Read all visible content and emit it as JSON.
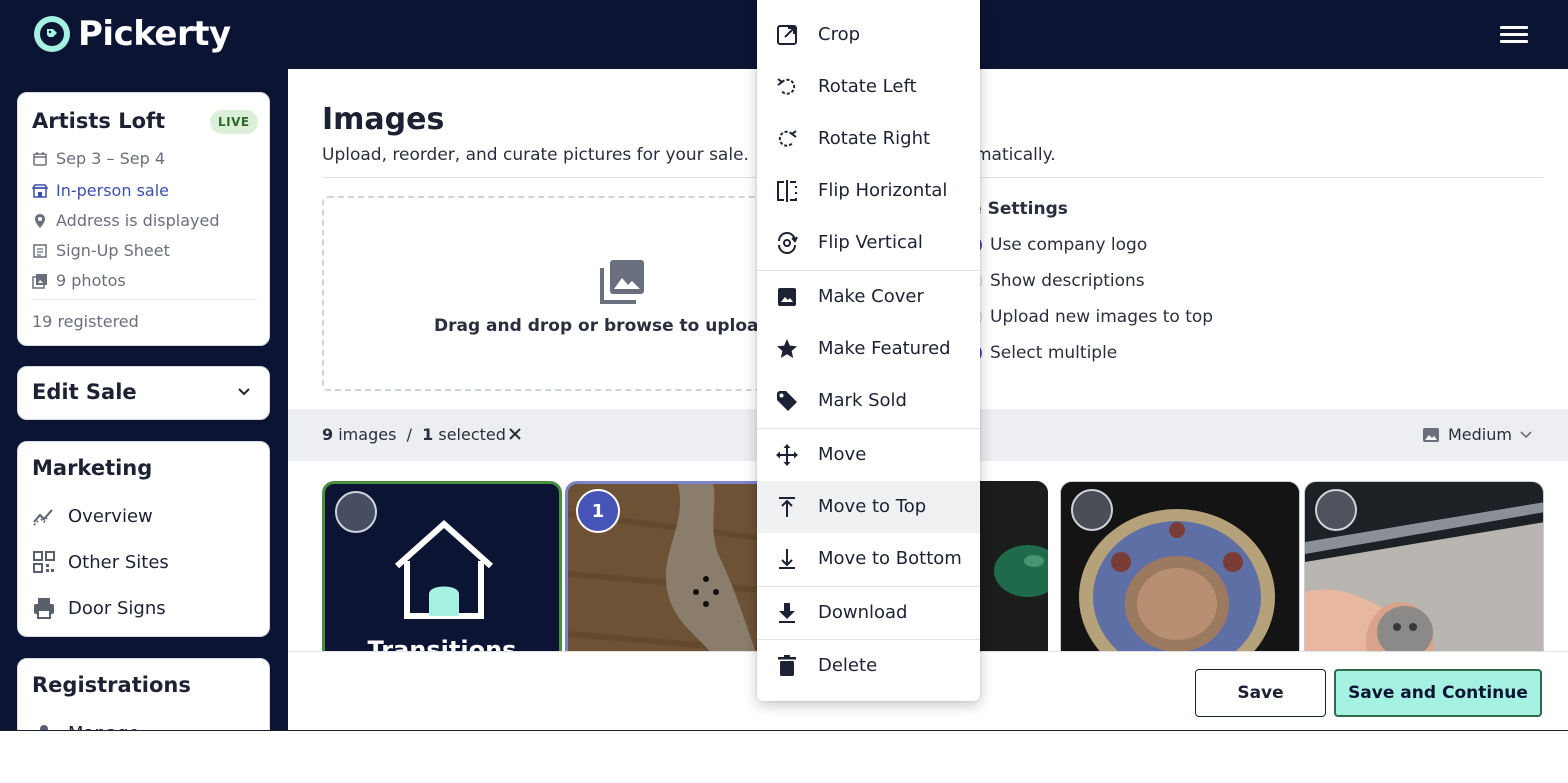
{
  "app": {
    "name": "Pickerty"
  },
  "sale": {
    "title": "Artists Loft",
    "status": "LIVE",
    "dates": "Sep 3 – Sep 4",
    "type": "In-person sale",
    "address": "Address is displayed",
    "signup": "Sign-Up Sheet",
    "photos": "9 photos",
    "registered": "19 registered"
  },
  "edit_sale": {
    "label": "Edit Sale"
  },
  "marketing": {
    "title": "Marketing",
    "items": [
      "Overview",
      "Other Sites",
      "Door Signs"
    ]
  },
  "registrations": {
    "title": "Registrations",
    "first_item": "Manage"
  },
  "main": {
    "title": "Images",
    "subtitle": "Upload, reorder, and curate pictures for your sale.",
    "subtitle_tail": "matically.",
    "dropzone_text": "Drag and drop or browse to upload p"
  },
  "settings": {
    "title": "ge Settings",
    "options": [
      {
        "label": "Use company logo",
        "checked": true
      },
      {
        "label": "Show descriptions",
        "checked": false
      },
      {
        "label": "Upload new images to top",
        "checked": false
      },
      {
        "label": "Select multiple",
        "checked": true
      }
    ]
  },
  "toolbar": {
    "image_count": "9",
    "images_label": "images",
    "divider": "/",
    "selected_count": "1",
    "selected_label": "selected",
    "size": "Medium"
  },
  "gallery": {
    "cover_text": "Transitions",
    "selected_number": "1"
  },
  "footer": {
    "save": "Save",
    "save_continue": "Save and Continue"
  },
  "context_menu": {
    "items": [
      {
        "label": "Crop",
        "icon": "crop-icon"
      },
      {
        "label": "Rotate Left",
        "icon": "rotate-left-icon"
      },
      {
        "label": "Rotate Right",
        "icon": "rotate-right-icon"
      },
      {
        "label": "Flip Horizontal",
        "icon": "flip-horizontal-icon"
      },
      {
        "label": "Flip Vertical",
        "icon": "flip-vertical-icon"
      },
      {
        "label": "Make Cover",
        "icon": "image-icon"
      },
      {
        "label": "Make Featured",
        "icon": "star-icon"
      },
      {
        "label": "Mark Sold",
        "icon": "tag-icon"
      },
      {
        "label": "Move",
        "icon": "move-icon"
      },
      {
        "label": "Move to Top",
        "icon": "move-to-top-icon"
      },
      {
        "label": "Move to Bottom",
        "icon": "move-to-bottom-icon"
      },
      {
        "label": "Download",
        "icon": "download-icon"
      },
      {
        "label": "Delete",
        "icon": "trash-icon"
      }
    ],
    "highlighted": "Move to Top"
  },
  "colors": {
    "navy": "#0c1434",
    "accent": "#a6f2e2",
    "link": "#3d4fb0",
    "live_badge": "#dcefd9"
  }
}
